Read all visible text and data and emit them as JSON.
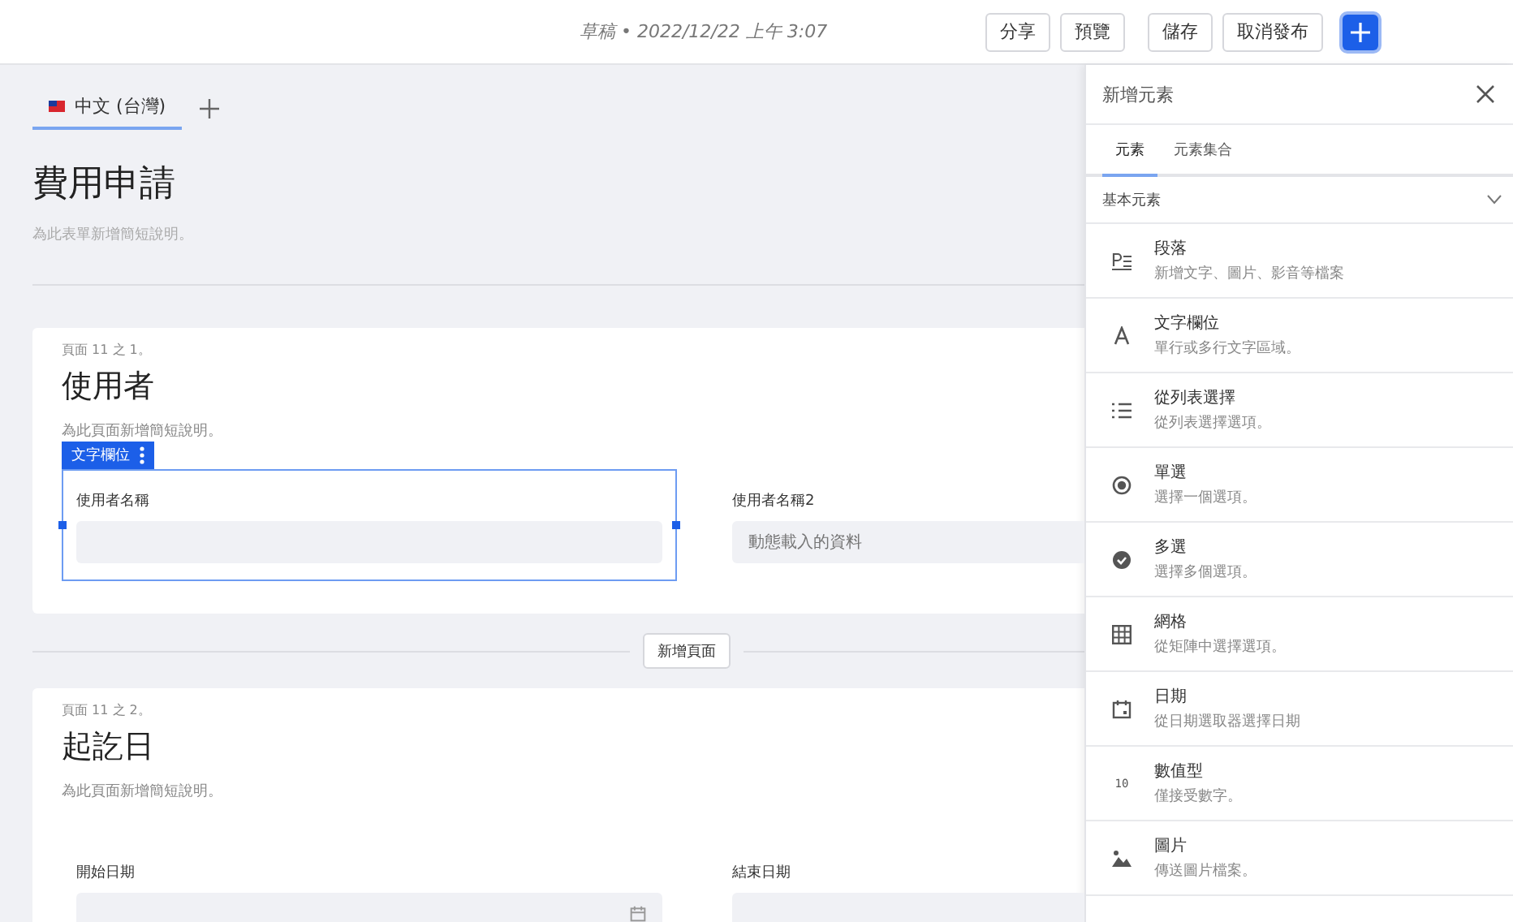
{
  "top_bar": {
    "status": "草稿 • 2022/12/22 上午 3:07",
    "button_groups": [
      [
        "分享",
        "預覽"
      ],
      [
        "儲存",
        "取消發布"
      ]
    ]
  },
  "language_tabs": [
    {
      "label": "中文 (台灣)",
      "selected": true
    }
  ],
  "form": {
    "title": "費用申請",
    "description": "為此表單新增簡短說明。",
    "pages": [
      {
        "counter": "頁面 11 之 1。",
        "title": "使用者",
        "description": "為此頁面新增簡短說明。",
        "fields": [
          {
            "kind": "text",
            "label": "使用者名稱",
            "selected": true,
            "selection_tag": "文字欄位"
          },
          {
            "kind": "text",
            "label": "使用者名稱2",
            "placeholder": "動態載入的資料",
            "selected": false
          }
        ]
      },
      {
        "counter": "頁面 11 之 2。",
        "title": "起訖日",
        "description": "為此頁面新增簡短說明。",
        "fields": [
          {
            "kind": "date",
            "label": "開始日期",
            "selected": false
          },
          {
            "kind": "date",
            "label": "結束日期",
            "selected": false
          }
        ]
      }
    ],
    "add_page_button": "新增頁面"
  },
  "panel": {
    "title": "新增元素",
    "tabs": [
      {
        "label": "元素",
        "selected": true
      },
      {
        "label": "元素集合",
        "selected": false
      }
    ],
    "section": {
      "title": "基本元素",
      "expanded": true
    },
    "items": [
      {
        "kind": "paragraph",
        "title": "段落",
        "description": "新增文字、圖片、影音等檔案"
      },
      {
        "kind": "text",
        "title": "文字欄位",
        "description": "單行或多行文字區域。"
      },
      {
        "kind": "list",
        "title": "從列表選擇",
        "description": "從列表選擇選項。"
      },
      {
        "kind": "radio",
        "title": "單選",
        "description": "選擇一個選項。"
      },
      {
        "kind": "checkbox",
        "title": "多選",
        "description": "選擇多個選項。"
      },
      {
        "kind": "grid",
        "title": "網格",
        "description": "從矩陣中選擇選項。"
      },
      {
        "kind": "date",
        "title": "日期",
        "description": "從日期選取器選擇日期"
      },
      {
        "kind": "number",
        "title": "數值型",
        "description": "僅接受數字。",
        "icon_text": "10"
      },
      {
        "kind": "image",
        "title": "圖片",
        "description": "傳送圖片檔案。"
      }
    ]
  }
}
